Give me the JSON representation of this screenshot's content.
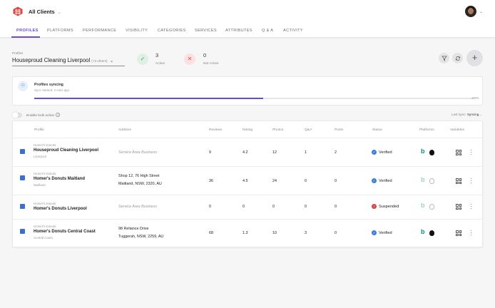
{
  "header": {
    "client_name": "All Clients",
    "chevron_icon": "chevron-down-icon",
    "logo_icon": "grid-logo-icon",
    "avatar_icon": "user-avatar"
  },
  "nav": {
    "tabs": [
      "PROFILES",
      "PLATFORMS",
      "PERFORMANCE",
      "VISIBILITY",
      "CATEGORIES",
      "SERVICES",
      "ATTRIBUTES",
      "Q & A",
      "ACTIVITY"
    ],
    "active": 0
  },
  "profiles_select": {
    "label": "Profiles",
    "value": "Houseproud Cleaning Liverpool",
    "others": "(+3 others)"
  },
  "stats": {
    "active": {
      "count": "3",
      "label": "Active"
    },
    "not_active": {
      "count": "0",
      "label": "Not Active"
    }
  },
  "actions": {
    "filter_icon": "filter-icon",
    "sync_icon": "sync-icon",
    "add_icon": "plus-icon"
  },
  "sync": {
    "title": "Profiles syncing",
    "subtitle": "Sync Started: 2 mins ago",
    "percent_label": "100%",
    "progress": 0.52
  },
  "bulk": {
    "label": "Enable bulk action",
    "last_sync_label": "Last sync:",
    "last_sync_value": "Syncing..."
  },
  "table": {
    "columns": [
      "Profile",
      "Address",
      "Reviews",
      "Rating",
      "Photos",
      "Q&A",
      "Posts",
      "Status",
      "Platforms",
      "Variables"
    ],
    "rows": [
      {
        "group": "Homer's Donuts",
        "name": "Houseproud Cleaning Liverpool",
        "location": "Liverpool",
        "address1": "Service Area Business",
        "address2": "",
        "reviews": "9",
        "rating": "4.2",
        "photos": "12",
        "qa": "1",
        "posts": "2",
        "status": "Verified",
        "status_color": "#3b7ddd",
        "bing_color": "#0f8a80",
        "apple_color": "#111111"
      },
      {
        "group": "Homer's Donuts",
        "name": "Homer's Donuts Maitland",
        "location": "Maitland",
        "address1": "Shop 12, 76 High Street",
        "address2": "Maitland, NSW, 2320, AU",
        "reviews": "36",
        "rating": "4.5",
        "photos": "24",
        "qa": "0",
        "posts": "0",
        "status": "Verified",
        "status_color": "#3b7ddd",
        "bing_color": "#9fd1cb",
        "apple_color": "#b9b9b9"
      },
      {
        "group": "Homer's Donuts",
        "name": "Homer's Donuts Liverpool",
        "location": "",
        "address1": "Service Area Business",
        "address2": "",
        "reviews": "0",
        "rating": "0",
        "photos": "0",
        "qa": "0",
        "posts": "0",
        "status": "Suspended",
        "status_color": "#d84646",
        "bing_color": "#9fd1cb",
        "apple_color": "#b9b9b9"
      },
      {
        "group": "Homer's Donuts",
        "name": "Homer's Donuts Central Coast",
        "location": "Central Coast",
        "address1": "98 Reliance Drive",
        "address2": "Tuggerah, NSW, 2259, AU",
        "reviews": "68",
        "rating": "1.3",
        "photos": "10",
        "qa": "3",
        "posts": "0",
        "status": "Verified",
        "status_color": "#3b7ddd",
        "bing_color": "#0f8a80",
        "apple_color": "#111111"
      }
    ]
  }
}
